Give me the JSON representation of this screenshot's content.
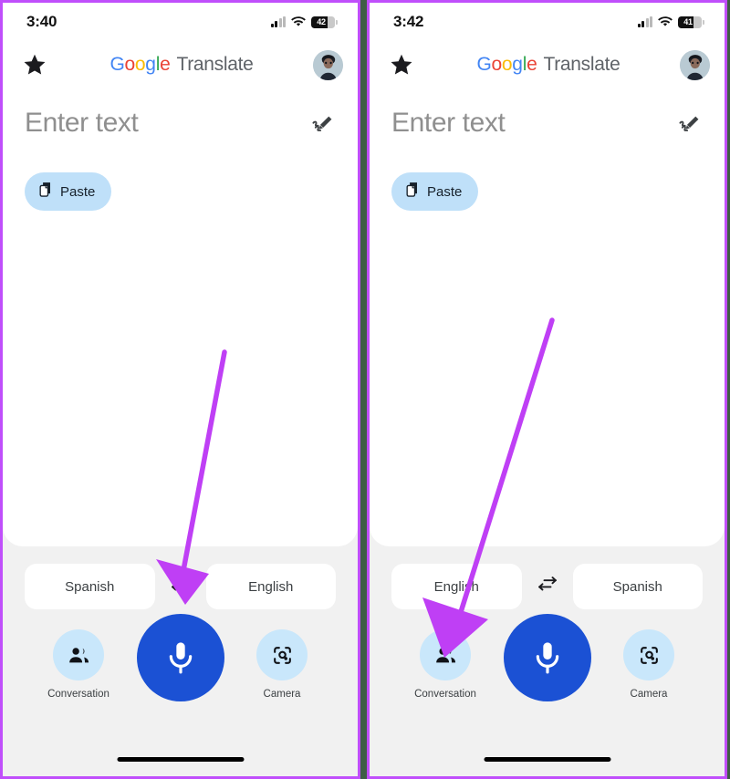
{
  "panels": [
    {
      "status": {
        "time": "3:40",
        "battery_pct": "42",
        "signal_icon": "cellular-signal-icon",
        "wifi_icon": "wifi-icon",
        "battery_icon": "battery-icon"
      },
      "appbar": {
        "star_icon": "star-icon",
        "brand_google": "Google",
        "brand_word": "Translate",
        "avatar_icon": "user-avatar"
      },
      "input": {
        "placeholder": "Enter text",
        "handwrite_icon": "handwriting-icon",
        "paste_label": "Paste",
        "paste_icon": "paste-icon"
      },
      "languages": {
        "source": "Spanish",
        "target": "English",
        "swap_icon": "swap-horizontal-icon"
      },
      "actions": {
        "conversation_label": "Conversation",
        "conversation_icon": "conversation-people-icon",
        "mic_icon": "microphone-icon",
        "camera_label": "Camera",
        "camera_icon": "camera-lens-icon"
      },
      "annotation": {
        "arrow_icon": "purple-arrow-pointing-to-swap-button",
        "target": "swap-languages-button"
      }
    },
    {
      "status": {
        "time": "3:42",
        "battery_pct": "41",
        "signal_icon": "cellular-signal-icon",
        "wifi_icon": "wifi-icon",
        "battery_icon": "battery-icon"
      },
      "appbar": {
        "star_icon": "star-icon",
        "brand_google": "Google",
        "brand_word": "Translate",
        "avatar_icon": "user-avatar"
      },
      "input": {
        "placeholder": "Enter text",
        "handwrite_icon": "handwriting-icon",
        "paste_label": "Paste",
        "paste_icon": "paste-icon"
      },
      "languages": {
        "source": "English",
        "target": "Spanish",
        "swap_icon": "swap-horizontal-icon"
      },
      "actions": {
        "conversation_label": "Conversation",
        "conversation_icon": "conversation-people-icon",
        "mic_icon": "microphone-icon",
        "camera_label": "Camera",
        "camera_icon": "camera-lens-icon"
      },
      "annotation": {
        "arrow_icon": "purple-arrow-pointing-to-conversation-button",
        "target": "conversation-button"
      }
    }
  ],
  "colors": {
    "annotation_arrow": "#bf3ff5",
    "frame_border": "#c04ffb",
    "mic_blue": "#1b51d4",
    "action_circle_blue": "#c9e7fb",
    "paste_chip_blue": "#bfe0f9",
    "page_background": "#f1f1f1",
    "google_blue": "#4285f4",
    "google_red": "#ea4335",
    "google_yellow": "#fbbc05",
    "google_green": "#34a853",
    "brand_gray": "#5f6368"
  }
}
